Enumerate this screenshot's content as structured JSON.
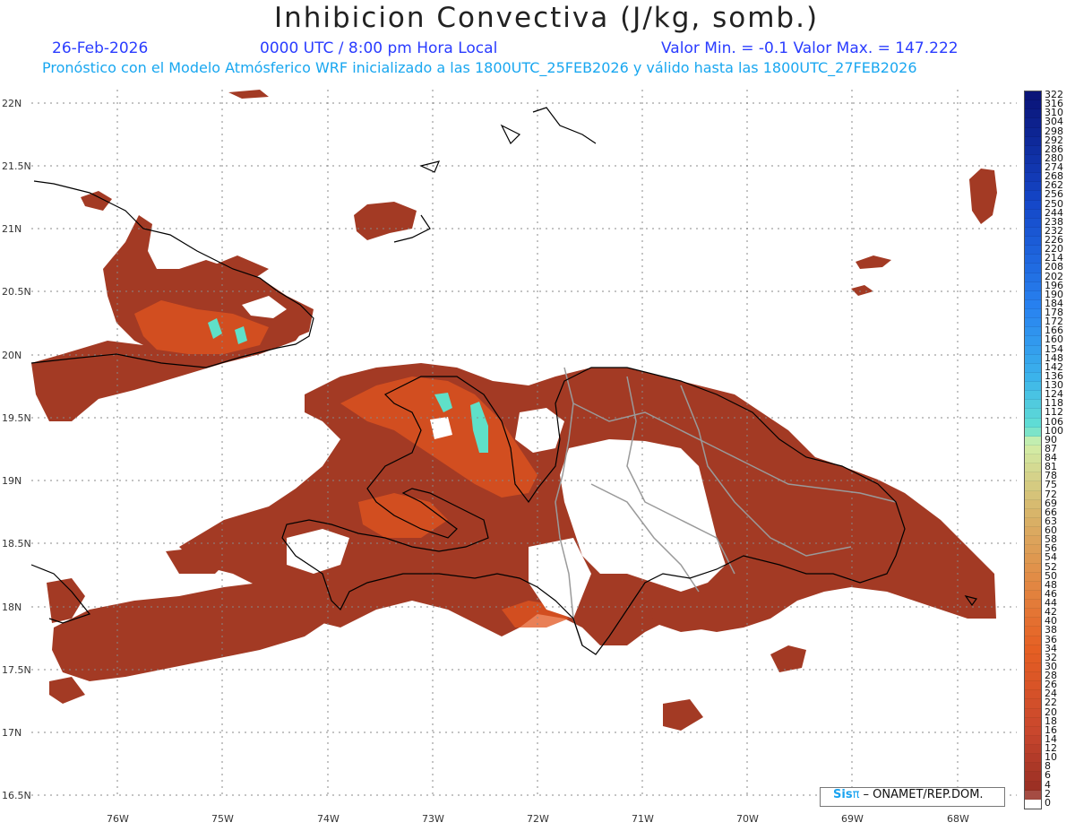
{
  "header": {
    "title": "Inhibicion Convectiva (J/kg, somb.)",
    "date": "26-Feb-2026",
    "time": "0000 UTC / 8:00 pm Hora Local",
    "minmax": "Valor Min. = -0.1  Valor Max. = 147.222",
    "model_info": "Pronóstico con el Modelo Atmósferico WRF inicializado a las 1800UTC_25FEB2026 y válido hasta las  1800UTC_27FEB2026"
  },
  "colors": {
    "header_blue": "#2a3cff",
    "header_cyan": "#19a7f0",
    "field_base": "#a33a24",
    "field_orange": "#e2561f",
    "field_high": "#5fe0c8",
    "coastline": "#000000",
    "borders": "#9a9a9a"
  },
  "lat_labels": [
    "22N",
    "21.5N",
    "21N",
    "20.5N",
    "20N",
    "19.5N",
    "19N",
    "18.5N",
    "18N",
    "17.5N",
    "17N",
    "16.5N"
  ],
  "lon_labels": [
    "76W",
    "75W",
    "74W",
    "73W",
    "72W",
    "71W",
    "70W",
    "69W",
    "68W"
  ],
  "colorbar": {
    "labels": [
      "322",
      "316",
      "310",
      "304",
      "298",
      "292",
      "286",
      "280",
      "274",
      "268",
      "262",
      "256",
      "250",
      "244",
      "238",
      "232",
      "226",
      "220",
      "214",
      "208",
      "202",
      "196",
      "190",
      "184",
      "178",
      "172",
      "166",
      "160",
      "154",
      "148",
      "142",
      "136",
      "130",
      "124",
      "118",
      "112",
      "106",
      "100",
      "90",
      "87",
      "84",
      "81",
      "78",
      "75",
      "72",
      "69",
      "66",
      "63",
      "60",
      "58",
      "56",
      "54",
      "52",
      "50",
      "48",
      "46",
      "44",
      "42",
      "40",
      "38",
      "36",
      "34",
      "32",
      "30",
      "28",
      "26",
      "24",
      "22",
      "20",
      "18",
      "16",
      "14",
      "12",
      "10",
      "8",
      "6",
      "4",
      "2",
      "0"
    ]
  },
  "credit": {
    "sis": "Sis",
    "pi": "π",
    "text": "– ONAMET/REP.DOM."
  }
}
